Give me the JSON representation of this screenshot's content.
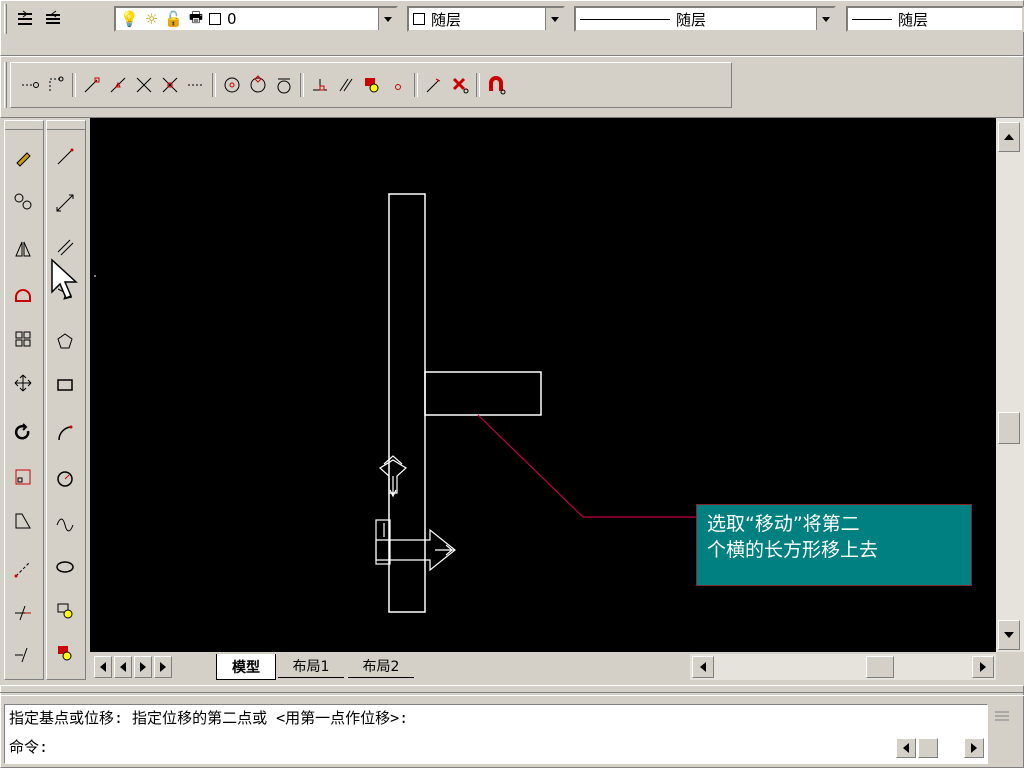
{
  "toolbar_layers": {
    "layer_combo_value": "0",
    "color_combo_value": "随层",
    "linetype_combo_value": "随层",
    "lineweight_combo_value": "随层"
  },
  "tabs": {
    "model": "模型",
    "layout1": "布局1",
    "layout2": "布局2"
  },
  "command": {
    "line1": "指定基点或位移: 指定位移的第二点或 <用第一点作位移>:",
    "line2": "命令:"
  },
  "callout": {
    "line1": "选取“移动”将第二",
    "line2": "个横的长方形移上去"
  },
  "colors": {
    "canvas": "#000000",
    "callout_bg": "#008080",
    "chrome": "#d4d0c8",
    "leader": "#c00040"
  }
}
